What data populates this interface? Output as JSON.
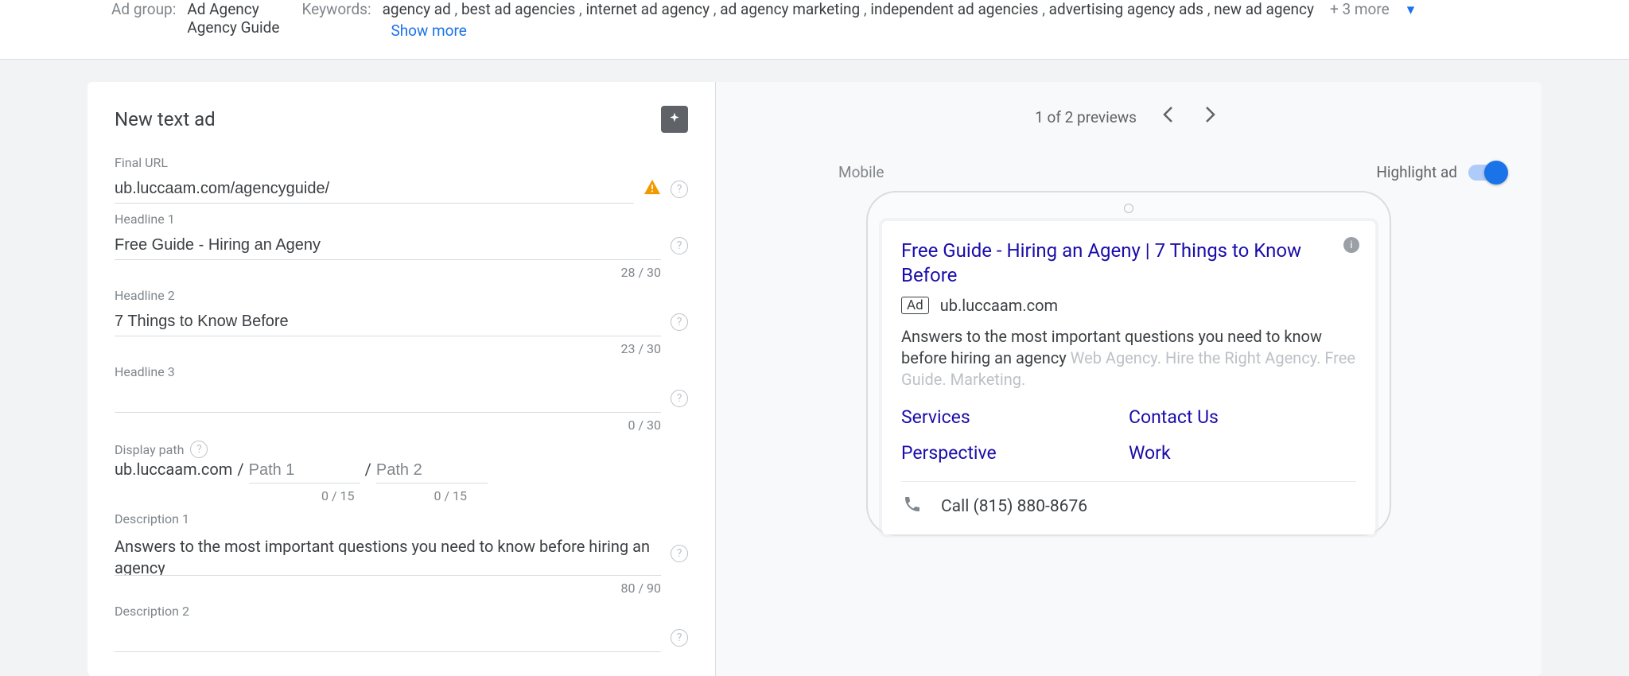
{
  "top": {
    "ad_group_label": "Ad group:",
    "ad_group_value_line1": "Ad Agency",
    "ad_group_value_line2": "Agency Guide",
    "keywords_label": "Keywords:",
    "keywords": [
      "agency ad",
      "best ad agencies",
      "internet ad agency",
      "ad agency marketing",
      "independent ad agencies",
      "advertising agency ads",
      "new ad agency"
    ],
    "keywords_more": "+ 3 more",
    "show_more": "Show more"
  },
  "form": {
    "title": "New text ad",
    "final_url_label": "Final URL",
    "final_url_value": "ub.luccaam.com/agencyguide/",
    "headline1_label": "Headline 1",
    "headline1_value": "Free Guide - Hiring an Ageny",
    "headline1_counter": "28 / 30",
    "headline2_label": "Headline 2",
    "headline2_value": "7 Things to Know Before",
    "headline2_counter": "23 / 30",
    "headline3_label": "Headline 3",
    "headline3_value": "",
    "headline3_counter": "0 / 30",
    "display_path_label": "Display path",
    "display_path_domain": "ub.luccaam.com",
    "path1_placeholder": "Path 1",
    "path2_placeholder": "Path 2",
    "path1_counter": "0 / 15",
    "path2_counter": "0 / 15",
    "description1_label": "Description 1",
    "description1_value": "Answers to the most important questions you need to know before hiring an agency",
    "description1_counter": "80 / 90",
    "description2_label": "Description 2"
  },
  "preview": {
    "counter": "1 of 2 previews",
    "highlight_label": "Highlight ad",
    "mobile_label": "Mobile",
    "ad_title": "Free Guide - Hiring an Ageny | 7 Things to Know Before",
    "ad_badge": "Ad",
    "ad_url": "ub.luccaam.com",
    "ad_desc_main": "Answers to the most important questions you need to know before hiring an agency ",
    "ad_desc_faded": "Web Agency. Hire the Right Agency. Free Guide. Marketing.",
    "sitelinks": [
      "Services",
      "Contact Us",
      "Perspective",
      "Work"
    ],
    "call_text": "Call (815) 880-8676"
  }
}
